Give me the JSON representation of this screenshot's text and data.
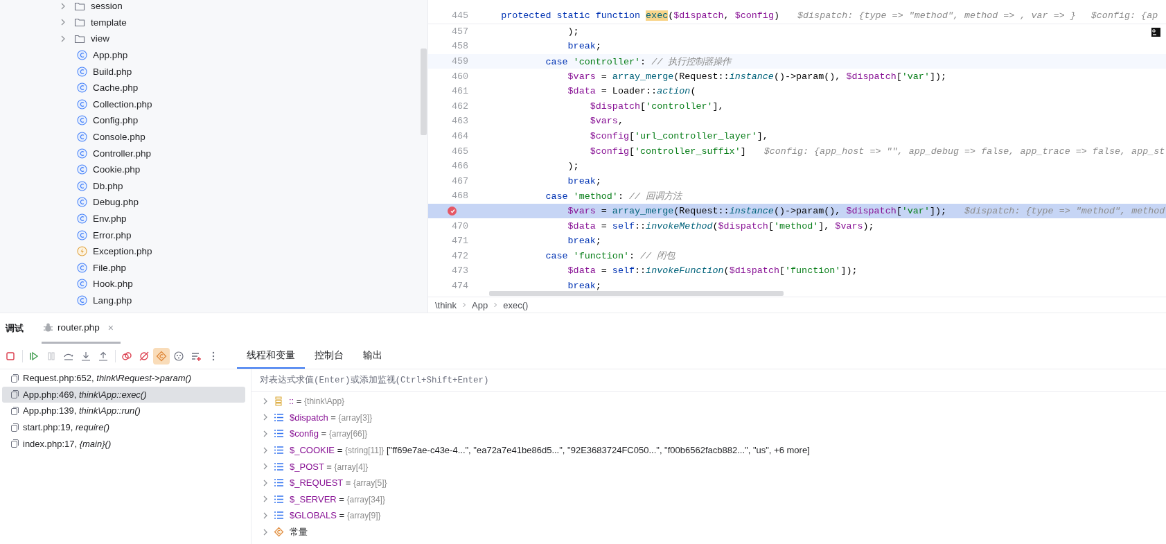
{
  "project_tree": [
    {
      "kind": "folder",
      "name": "session"
    },
    {
      "kind": "folder",
      "name": "template"
    },
    {
      "kind": "folder",
      "name": "view"
    },
    {
      "kind": "class",
      "name": "App.php"
    },
    {
      "kind": "class",
      "name": "Build.php"
    },
    {
      "kind": "class",
      "name": "Cache.php"
    },
    {
      "kind": "class",
      "name": "Collection.php"
    },
    {
      "kind": "class",
      "name": "Config.php"
    },
    {
      "kind": "class",
      "name": "Console.php"
    },
    {
      "kind": "class",
      "name": "Controller.php"
    },
    {
      "kind": "class",
      "name": "Cookie.php"
    },
    {
      "kind": "class",
      "name": "Db.php"
    },
    {
      "kind": "class",
      "name": "Debug.php"
    },
    {
      "kind": "class",
      "name": "Env.php"
    },
    {
      "kind": "class",
      "name": "Error.php"
    },
    {
      "kind": "exception",
      "name": "Exception.php"
    },
    {
      "kind": "class",
      "name": "File.php"
    },
    {
      "kind": "class",
      "name": "Hook.php"
    },
    {
      "kind": "class",
      "name": "Lang.php"
    }
  ],
  "editor": {
    "sticky_line": {
      "number": "445",
      "tokens": [
        {
          "text": "    protected static function ",
          "kind": "kw"
        },
        {
          "text": "exec",
          "kind": "match"
        },
        {
          "text": "(",
          "kind": "plain"
        },
        {
          "text": "$dispatch",
          "kind": "var"
        },
        {
          "text": ", ",
          "kind": "plain"
        },
        {
          "text": "$config",
          "kind": "var"
        },
        {
          "text": ")",
          "kind": "plain"
        }
      ],
      "hints": [
        "$dispatch: {type => \"method\", method => , var => }",
        "$config: {ap"
      ]
    },
    "lines": [
      {
        "number": "457",
        "caret_line": false,
        "execution_point": false,
        "breakpoint": false,
        "tokens": [
          {
            "text": "                );",
            "kind": "plain"
          }
        ]
      },
      {
        "number": "458",
        "caret_line": false,
        "execution_point": false,
        "breakpoint": false,
        "tokens": [
          {
            "text": "                break",
            "kind": "kw"
          },
          {
            "text": ";",
            "kind": "plain"
          }
        ]
      },
      {
        "number": "459",
        "caret_line": true,
        "execution_point": false,
        "breakpoint": false,
        "tokens": [
          {
            "text": "            case ",
            "kind": "kw"
          },
          {
            "text": "'controller'",
            "kind": "str"
          },
          {
            "text": ": ",
            "kind": "plain"
          },
          {
            "text": "// 执行控制器操作",
            "kind": "cmt"
          }
        ]
      },
      {
        "number": "460",
        "caret_line": false,
        "execution_point": false,
        "breakpoint": false,
        "tokens": [
          {
            "text": "                $vars",
            "kind": "var"
          },
          {
            "text": " = ",
            "kind": "plain"
          },
          {
            "text": "array_merge",
            "kind": "fn"
          },
          {
            "text": "(Request::",
            "kind": "plain"
          },
          {
            "text": "instance",
            "kind": "static"
          },
          {
            "text": "()->param(), ",
            "kind": "plain"
          },
          {
            "text": "$dispatch",
            "kind": "var"
          },
          {
            "text": "[",
            "kind": "plain"
          },
          {
            "text": "'var'",
            "kind": "str"
          },
          {
            "text": "]);",
            "kind": "plain"
          }
        ]
      },
      {
        "number": "461",
        "caret_line": false,
        "execution_point": false,
        "breakpoint": false,
        "tokens": [
          {
            "text": "                $data",
            "kind": "var"
          },
          {
            "text": " = Loader::",
            "kind": "plain"
          },
          {
            "text": "action",
            "kind": "static"
          },
          {
            "text": "(",
            "kind": "plain"
          }
        ]
      },
      {
        "number": "462",
        "caret_line": false,
        "execution_point": false,
        "breakpoint": false,
        "tokens": [
          {
            "text": "                    $dispatch",
            "kind": "var"
          },
          {
            "text": "[",
            "kind": "plain"
          },
          {
            "text": "'controller'",
            "kind": "str"
          },
          {
            "text": "],",
            "kind": "plain"
          }
        ]
      },
      {
        "number": "463",
        "caret_line": false,
        "execution_point": false,
        "breakpoint": false,
        "tokens": [
          {
            "text": "                    $vars",
            "kind": "var"
          },
          {
            "text": ",",
            "kind": "plain"
          }
        ]
      },
      {
        "number": "464",
        "caret_line": false,
        "execution_point": false,
        "breakpoint": false,
        "tokens": [
          {
            "text": "                    $config",
            "kind": "var"
          },
          {
            "text": "[",
            "kind": "plain"
          },
          {
            "text": "'url_controller_layer'",
            "kind": "str"
          },
          {
            "text": "],",
            "kind": "plain"
          }
        ]
      },
      {
        "number": "465",
        "caret_line": false,
        "execution_point": false,
        "breakpoint": false,
        "tokens": [
          {
            "text": "                    $config",
            "kind": "var"
          },
          {
            "text": "[",
            "kind": "plain"
          },
          {
            "text": "'controller_suffix'",
            "kind": "str"
          },
          {
            "text": "]",
            "kind": "plain"
          }
        ],
        "hints": [
          "$config: {app_host => \"\", app_debug => false, app_trace => false, app_st"
        ]
      },
      {
        "number": "466",
        "caret_line": false,
        "execution_point": false,
        "breakpoint": false,
        "tokens": [
          {
            "text": "                );",
            "kind": "plain"
          }
        ]
      },
      {
        "number": "467",
        "caret_line": false,
        "execution_point": false,
        "breakpoint": false,
        "tokens": [
          {
            "text": "                break",
            "kind": "kw"
          },
          {
            "text": ";",
            "kind": "plain"
          }
        ]
      },
      {
        "number": "468",
        "caret_line": false,
        "execution_point": false,
        "breakpoint": false,
        "tokens": [
          {
            "text": "            case ",
            "kind": "kw"
          },
          {
            "text": "'method'",
            "kind": "str"
          },
          {
            "text": ": ",
            "kind": "plain"
          },
          {
            "text": "// 回调方法",
            "kind": "cmt"
          }
        ]
      },
      {
        "caret_line": false,
        "execution_point": true,
        "breakpoint": true,
        "tokens": [
          {
            "text": "                $vars",
            "kind": "var"
          },
          {
            "text": " = ",
            "kind": "plain"
          },
          {
            "text": "array_merge",
            "kind": "fn"
          },
          {
            "text": "(Request::",
            "kind": "plain"
          },
          {
            "text": "instance",
            "kind": "static"
          },
          {
            "text": "()->param(), ",
            "kind": "plain"
          },
          {
            "text": "$dispatch",
            "kind": "var"
          },
          {
            "text": "[",
            "kind": "plain"
          },
          {
            "text": "'var'",
            "kind": "str"
          },
          {
            "text": "]);",
            "kind": "plain"
          }
        ],
        "hints": [
          "$dispatch: {type => \"method\", method"
        ]
      },
      {
        "number": "470",
        "caret_line": false,
        "execution_point": false,
        "breakpoint": false,
        "tokens": [
          {
            "text": "                $data",
            "kind": "var"
          },
          {
            "text": " = ",
            "kind": "plain"
          },
          {
            "text": "self",
            "kind": "kw"
          },
          {
            "text": "::",
            "kind": "plain"
          },
          {
            "text": "invokeMethod",
            "kind": "static"
          },
          {
            "text": "(",
            "kind": "plain"
          },
          {
            "text": "$dispatch",
            "kind": "var"
          },
          {
            "text": "[",
            "kind": "plain"
          },
          {
            "text": "'method'",
            "kind": "str"
          },
          {
            "text": "], ",
            "kind": "plain"
          },
          {
            "text": "$vars",
            "kind": "var"
          },
          {
            "text": ");",
            "kind": "plain"
          }
        ]
      },
      {
        "number": "471",
        "caret_line": false,
        "execution_point": false,
        "breakpoint": false,
        "tokens": [
          {
            "text": "                break",
            "kind": "kw"
          },
          {
            "text": ";",
            "kind": "plain"
          }
        ]
      },
      {
        "number": "472",
        "caret_line": false,
        "execution_point": false,
        "breakpoint": false,
        "tokens": [
          {
            "text": "            case ",
            "kind": "kw"
          },
          {
            "text": "'function'",
            "kind": "str"
          },
          {
            "text": ": ",
            "kind": "plain"
          },
          {
            "text": "// 闭包",
            "kind": "cmt"
          }
        ]
      },
      {
        "number": "473",
        "caret_line": false,
        "execution_point": false,
        "breakpoint": false,
        "tokens": [
          {
            "text": "                $data",
            "kind": "var"
          },
          {
            "text": " = ",
            "kind": "plain"
          },
          {
            "text": "self",
            "kind": "kw"
          },
          {
            "text": "::",
            "kind": "plain"
          },
          {
            "text": "invokeFunction",
            "kind": "static"
          },
          {
            "text": "(",
            "kind": "plain"
          },
          {
            "text": "$dispatch",
            "kind": "var"
          },
          {
            "text": "[",
            "kind": "plain"
          },
          {
            "text": "'function'",
            "kind": "str"
          },
          {
            "text": "]);",
            "kind": "plain"
          }
        ]
      },
      {
        "number": "474",
        "caret_line": false,
        "execution_point": false,
        "breakpoint": false,
        "tokens": [
          {
            "text": "                break",
            "kind": "kw"
          },
          {
            "text": ";",
            "kind": "plain"
          }
        ]
      }
    ],
    "breadcrumbs": [
      "\\think",
      "App",
      "exec()"
    ]
  },
  "debug": {
    "title": "调试",
    "session_tabs": [
      {
        "label": "router.php",
        "close": "×",
        "selected": true
      }
    ],
    "toolbar": [
      {
        "kind": "stop",
        "selected": false,
        "disabled": false
      },
      {
        "kind": "resume",
        "selected": false,
        "disabled": false
      },
      {
        "kind": "pause",
        "selected": false,
        "disabled": true
      },
      {
        "kind": "step_over",
        "selected": false,
        "disabled": false
      },
      {
        "kind": "step_into",
        "selected": false,
        "disabled": false
      },
      {
        "kind": "step_out",
        "selected": false,
        "disabled": false
      },
      {
        "kind": "breakpoints",
        "selected": false,
        "disabled": false
      },
      {
        "kind": "mute",
        "selected": false,
        "disabled": false
      },
      {
        "kind": "class_toggle",
        "selected": true,
        "disabled": false
      },
      {
        "kind": "dots",
        "selected": false,
        "disabled": false
      },
      {
        "kind": "add_watch",
        "selected": false,
        "disabled": false
      },
      {
        "kind": "more",
        "selected": false,
        "disabled": false
      }
    ],
    "view_tabs": [
      {
        "label": "线程和变量",
        "selected": true
      },
      {
        "label": "控制台",
        "selected": false
      },
      {
        "label": "输出",
        "selected": false
      }
    ],
    "frames": [
      {
        "file": "Request.php:652,",
        "method": "think\\Request->param()",
        "selected": false
      },
      {
        "file": "App.php:469,",
        "method": "think\\App::exec()",
        "selected": true
      },
      {
        "file": "App.php:139,",
        "method": "think\\App::run()",
        "selected": false
      },
      {
        "file": "start.php:19,",
        "method": "require()",
        "selected": false
      },
      {
        "file": "index.php:17,",
        "method": "{main}()",
        "selected": false
      }
    ],
    "eval_placeholder": "对表达式求值(Enter)或添加监视(Ctrl+Shift+Enter)",
    "variables": [
      {
        "kind": "static",
        "name": "::",
        "op": "=",
        "type": "{think\\App}"
      },
      {
        "kind": "array",
        "name": "$dispatch",
        "op": "=",
        "type": "{array[3]}"
      },
      {
        "kind": "array",
        "name": "$config",
        "op": "=",
        "type": "{array[66]}"
      },
      {
        "kind": "array",
        "name": "$_COOKIE",
        "op": "=",
        "type": "{string[11]}",
        "preview": "[\"ff69e7ae-c43e-4...\", \"ea72a7e41be86d5...\", \"92E3683724FC050...\", \"f00b6562facb882...\", \"us\", +6 more]"
      },
      {
        "kind": "array",
        "name": "$_POST",
        "op": "=",
        "type": "{array[4]}"
      },
      {
        "kind": "array",
        "name": "$_REQUEST",
        "op": "=",
        "type": "{array[5]}"
      },
      {
        "kind": "array",
        "name": "$_SERVER",
        "op": "=",
        "type": "{array[34]}"
      },
      {
        "kind": "array",
        "name": "$GLOBALS",
        "op": "=",
        "type": "{array[9]}"
      },
      {
        "kind": "constants",
        "name": "常量"
      }
    ]
  }
}
